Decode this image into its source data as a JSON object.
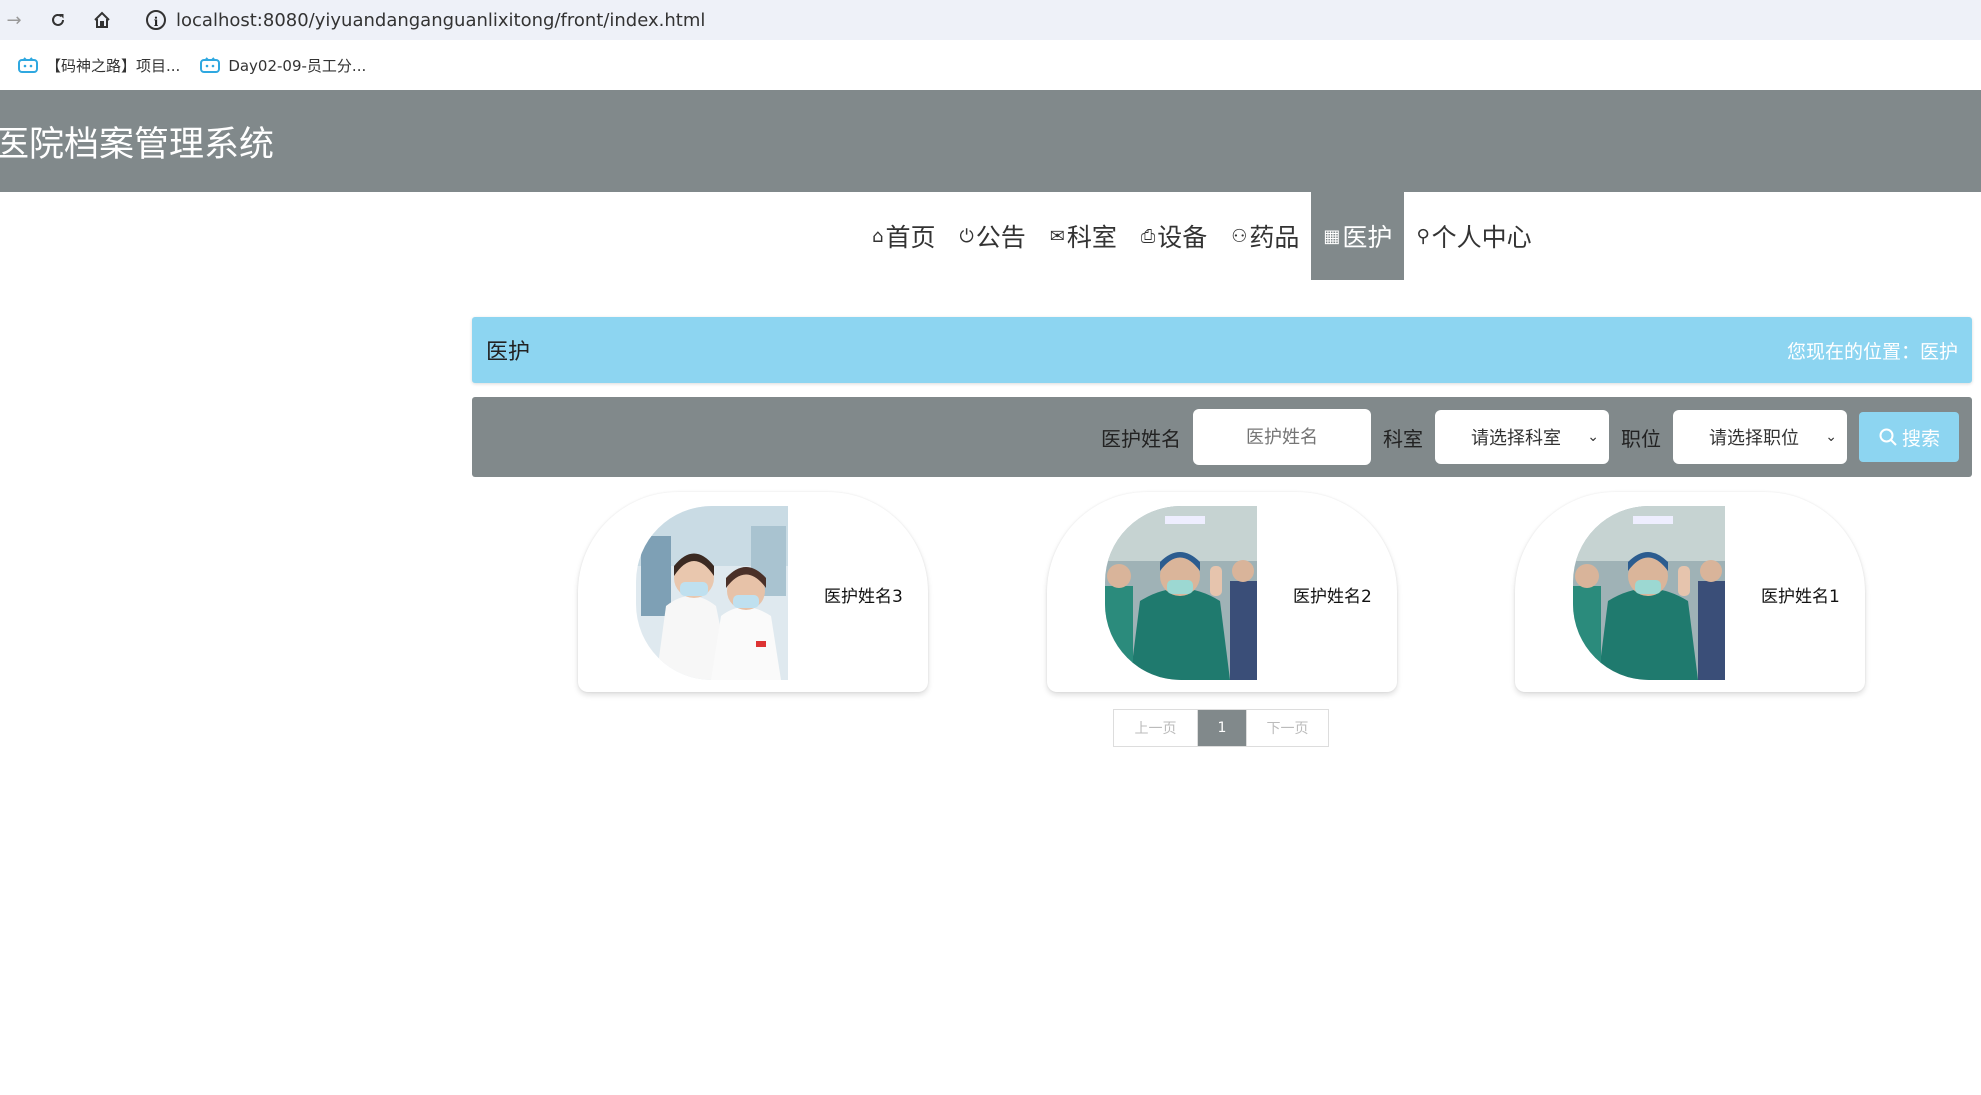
{
  "browser": {
    "url": "localhost:8080/yiyuandanganguanlixitong/front/index.html",
    "bookmarks": [
      {
        "label": "【码神之路】项目..."
      },
      {
        "label": "Day02-09-员工分..."
      }
    ]
  },
  "header": {
    "title": "医院档案管理系统"
  },
  "nav": {
    "items": [
      {
        "icon": "⌂",
        "label": "首页"
      },
      {
        "icon": "⏻",
        "label": "公告"
      },
      {
        "icon": "✉",
        "label": "科室"
      },
      {
        "icon": "⎙",
        "label": "设备"
      },
      {
        "icon": "⚇",
        "label": "药品"
      },
      {
        "icon": "▦",
        "label": "医护"
      },
      {
        "icon": "⚲",
        "label": "个人中心"
      }
    ],
    "active": "医护"
  },
  "breadcrumb": {
    "title": "医护",
    "location": "您现在的位置：医护"
  },
  "search": {
    "name_label": "医护姓名",
    "name_placeholder": "医护姓名",
    "dept_label": "科室",
    "dept_value": "请选择科室",
    "position_label": "职位",
    "position_value": "请选择职位",
    "button_label": "搜索"
  },
  "cards": [
    {
      "name": "医护姓名3"
    },
    {
      "name": "医护姓名2"
    },
    {
      "name": "医护姓名1"
    }
  ],
  "pagination": {
    "prev": "上一页",
    "current": "1",
    "next": "下一页"
  },
  "colors": {
    "header_bg": "#81898b",
    "accent": "#8dd5f1"
  }
}
